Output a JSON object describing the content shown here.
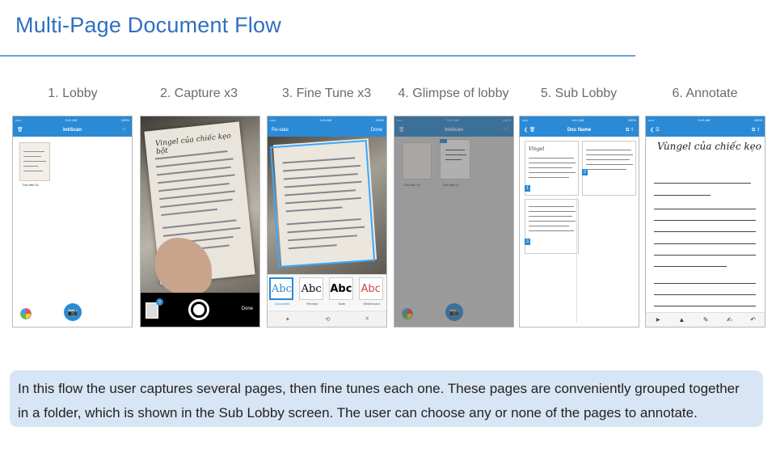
{
  "title": "Multi-Page Document Flow",
  "steps": [
    {
      "label": "1. Lobby"
    },
    {
      "label": "2. Capture x3"
    },
    {
      "label": "3. Fine Tune x3"
    },
    {
      "label": "4. Glimpse of lobby"
    },
    {
      "label": "5. Sub Lobby"
    },
    {
      "label": "6. Annotate"
    }
  ],
  "phones": {
    "lobby": {
      "status_left": "•••••",
      "status_time": "9:41 AM",
      "status_right": "100%",
      "nav_title": "InkScan",
      "thumb_caption": "Doc title 01"
    },
    "capture": {
      "book_heading": "Vingel của chiếc kẹo bột",
      "badge_count": "3",
      "done_label": "Done"
    },
    "tune": {
      "status_time": "9:41 AM",
      "nav_left": "Re-take",
      "nav_right": "Done",
      "filters": [
        {
          "glyph": "Abc",
          "name": "Document"
        },
        {
          "glyph": "Abc",
          "name": "Receipt"
        },
        {
          "glyph": "Abc",
          "name": "Note"
        },
        {
          "glyph": "Abc",
          "name": "Whiteboard"
        }
      ]
    },
    "glimpse": {
      "status_time": "9:41 AM",
      "nav_title": "InkScan",
      "thumb_caption_1": "Doc title 01",
      "thumb_caption_2": "Doc title 02"
    },
    "sublobby": {
      "status_time": "9:41 AM",
      "nav_title": "Doc Name",
      "page_numbers": [
        "1",
        "2",
        "3"
      ]
    },
    "annotate": {
      "status_time": "9:41 AM",
      "heading": "Vùngel của chiếc kẹo bột"
    }
  },
  "icons": {
    "trash": "trash-icon",
    "cart": "cart-icon",
    "back": "chevron-left-icon",
    "camera": "camera-icon",
    "color_wheel": "color-wheel-icon"
  },
  "caption": {
    "line1": "In this flow the user captures several pages, then fine tunes each one. These pages are conveniently grouped  together",
    "line2": "in a folder, which is shown in the Sub Lobby screen. The user can choose any or none of the pages to annotate."
  },
  "colors": {
    "title": "#2f6fbf",
    "nav_blue": "#2a8ad6",
    "caption_bg": "#d8e5f4"
  }
}
